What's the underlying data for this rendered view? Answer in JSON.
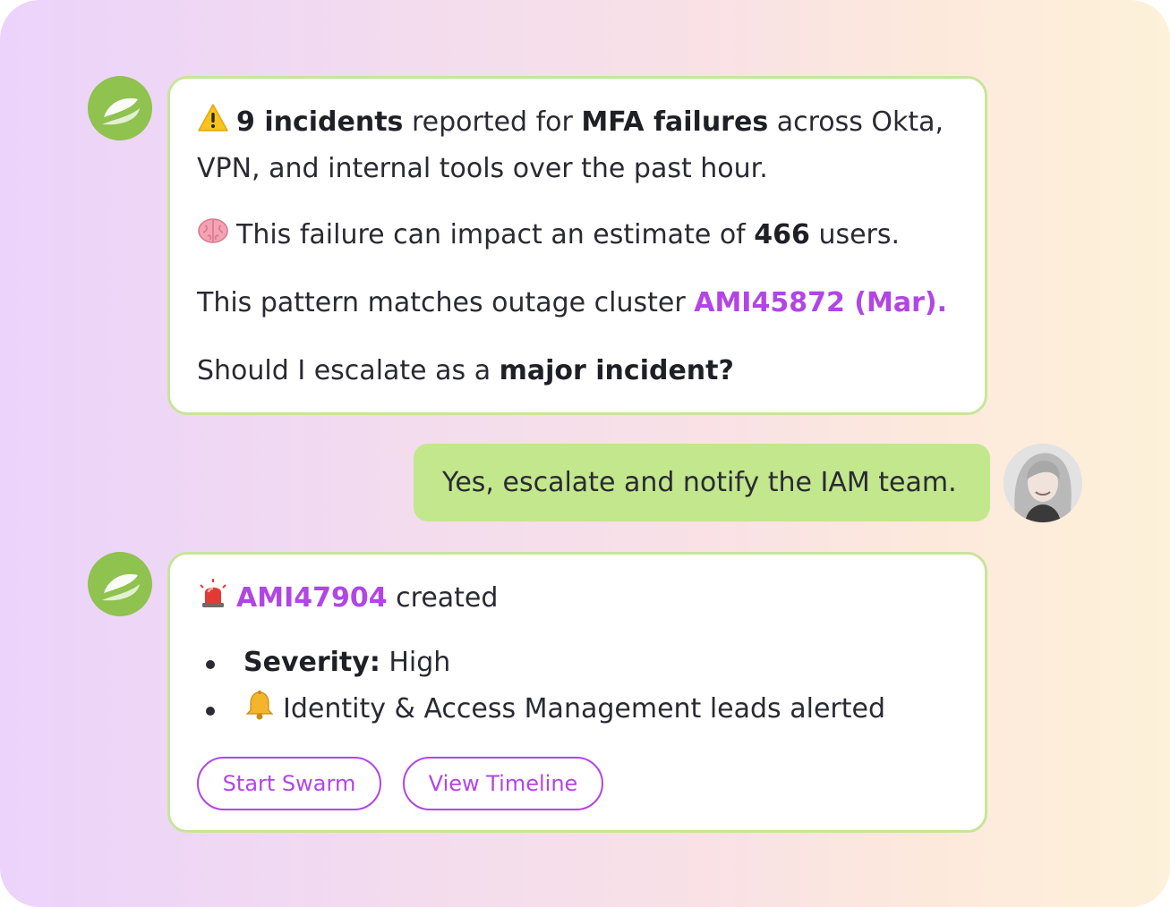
{
  "colors": {
    "accent": "#b245e6",
    "bot_green": "#8fc24e",
    "user_bubble": "#c3e78c",
    "card_border": "#c7e59a"
  },
  "bot_message_1": {
    "warning_icon": "warning-icon",
    "line1_count": "9 incidents",
    "line1_mid": " reported for ",
    "line1_topic": "MFA failures",
    "line1_end": " across Okta,",
    "line2": "VPN, and internal tools over the past hour.",
    "brain_icon": "brain-icon",
    "impact_pre": "This failure can impact an estimate of ",
    "impact_count": "466",
    "impact_post": " users.",
    "pattern_pre": "This pattern matches outage cluster ",
    "pattern_link": "AMI45872 (Mar).",
    "question_pre": "Should I escalate as a ",
    "question_bold": "major incident?"
  },
  "user_message": {
    "text": "Yes, escalate and notify the IAM team."
  },
  "bot_message_2": {
    "siren_icon": "siren-icon",
    "incident_id": "AMI47904",
    "created_text": " created",
    "severity_label": "Severity:",
    "severity_value": " High",
    "bell_icon": "bell-icon",
    "alert_text": "Identity & Access Management leads alerted",
    "buttons": {
      "start_swarm": "Start Swarm",
      "view_timeline": "View Timeline"
    }
  }
}
